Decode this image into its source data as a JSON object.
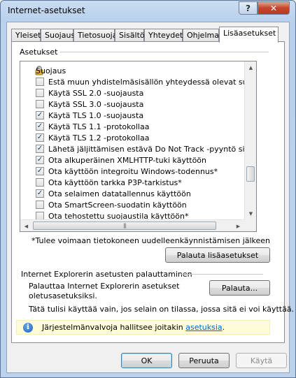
{
  "window": {
    "title": "Internet-asetukset",
    "help_glyph": "?",
    "close_glyph": "✕"
  },
  "tabs": [
    {
      "label": "Yleiset"
    },
    {
      "label": "Suojaus"
    },
    {
      "label": "Tietosuoja"
    },
    {
      "label": "Sisältö"
    },
    {
      "label": "Yhteydet"
    },
    {
      "label": "Ohjelmat"
    },
    {
      "label": "Lisäasetukset",
      "active": true
    }
  ],
  "settings": {
    "group_label": "Asetukset",
    "category": "Suojaus",
    "items": [
      {
        "label": "Estä muun yhdistelmäsisällön yhteydessä olevat suojaamattomat kuvat",
        "checked": false
      },
      {
        "label": "Käytä SSL 2.0 -suojausta",
        "checked": false
      },
      {
        "label": "Käytä SSL 3.0 -suojausta",
        "checked": false
      },
      {
        "label": "Käytä TLS 1.0 -suojausta",
        "checked": true
      },
      {
        "label": "Käytä TLS 1.1 -protokollaa",
        "checked": true
      },
      {
        "label": "Käytä TLS 1.2 -protokollaa",
        "checked": true
      },
      {
        "label": "Lähetä jäljittämisen estävä Do Not Track -pyyntö sivustoihin",
        "checked": true
      },
      {
        "label": "Ota alkuperäinen XMLHTTP-tuki käyttöön",
        "checked": true
      },
      {
        "label": "Ota käyttöön integroitu Windows-todennus*",
        "checked": true
      },
      {
        "label": "Ota käyttöön tarkka P3P-tarkistus*",
        "checked": false
      },
      {
        "label": "Ota selaimen datatallennus käyttöön",
        "checked": true
      },
      {
        "label": "Ota SmartScreen-suodatin käyttöön",
        "checked": false
      },
      {
        "label": "Ota tehostettu suojaustila käyttöön*",
        "checked": false
      }
    ],
    "footnote": "*Tulee voimaan tietokoneen uudelleenkäynnistämisen jälkeen",
    "restore_advanced_button": "Palauta lisäasetukset"
  },
  "reset": {
    "group_label": "Internet Explorerin asetusten palauttaminen",
    "description_line1": "Palauttaa Internet Explorerin asetukset",
    "description_line2": "oletusasetuksiksi.",
    "reset_button": "Palauta...",
    "warning": "Tätä tulisi käyttää vain, jos selain on tilassa, jossa sitä ei voi käyttää."
  },
  "infobar": {
    "icon": "info-icon",
    "text": "Järjestelmänvalvoja hallitsee joitakin ",
    "link": "asetuksia",
    "suffix": "."
  },
  "buttons": {
    "ok": "OK",
    "cancel": "Peruuta",
    "apply": "Käytä"
  }
}
